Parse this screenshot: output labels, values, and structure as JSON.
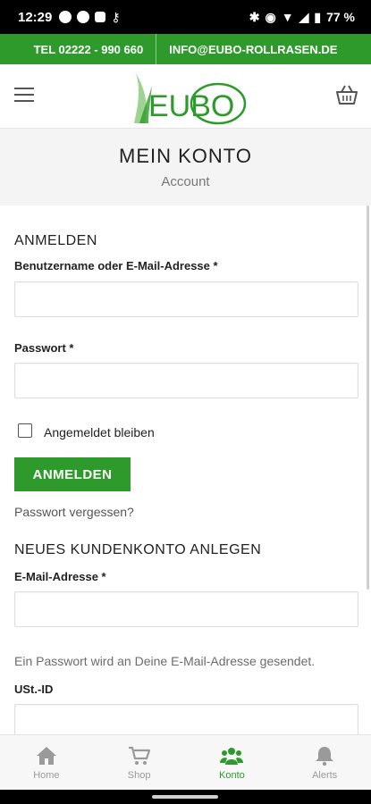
{
  "status_bar": {
    "time": "12:29",
    "battery": "77 %"
  },
  "contact": {
    "phone": "TEL 02222 - 990 660",
    "email": "INFO@EUBO-ROLLRASEN.DE"
  },
  "header": {
    "logo_text": "EUBO"
  },
  "page": {
    "title": "MEIN KONTO",
    "subtitle": "Account"
  },
  "login": {
    "section_title": "ANMELDEN",
    "username_label": "Benutzername oder E-Mail-Adresse *",
    "username_value": "",
    "password_label": "Passwort *",
    "password_value": "",
    "remember_label": "Angemeldet bleiben",
    "remember_checked": false,
    "submit_label": "ANMELDEN",
    "forgot_link": "Passwort vergessen?"
  },
  "register": {
    "section_title": "NEUES KUNDENKONTO ANLEGEN",
    "email_label": "E-Mail-Adresse *",
    "email_value": "",
    "note": "Ein Passwort wird an Deine E-Mail-Adresse gesendet.",
    "vat_label": "USt.-ID",
    "vat_value": ""
  },
  "bottom_nav": {
    "items": [
      {
        "label": "Home",
        "icon": "home-icon"
      },
      {
        "label": "Shop",
        "icon": "cart-icon"
      },
      {
        "label": "Konto",
        "icon": "users-icon",
        "active": true
      },
      {
        "label": "Alerts",
        "icon": "bell-icon"
      }
    ]
  },
  "colors": {
    "brand_green": "#2f9a2c",
    "inactive_gray": "#9a9a9a"
  }
}
